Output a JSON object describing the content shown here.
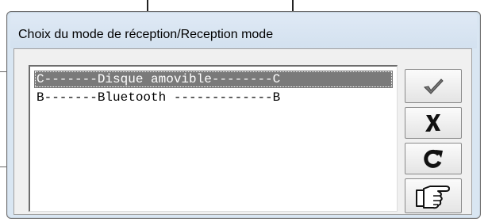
{
  "dialog": {
    "title": "Choix du mode de réception/Reception mode"
  },
  "list": {
    "items": [
      {
        "label": "C-------Disque amovible--------C",
        "selected": true
      },
      {
        "label": "B-------Bluetooth -------------B",
        "selected": false
      }
    ]
  },
  "buttons": {
    "ok": {
      "icon": "checkmark-icon"
    },
    "cancel": {
      "icon": "x-cancel-icon"
    },
    "refresh": {
      "icon": "refresh-icon"
    },
    "next": {
      "icon": "pointing-hand-icon"
    }
  },
  "colors": {
    "selection": "#7a7a7a",
    "dialog_frame": "#d9e6f2"
  }
}
